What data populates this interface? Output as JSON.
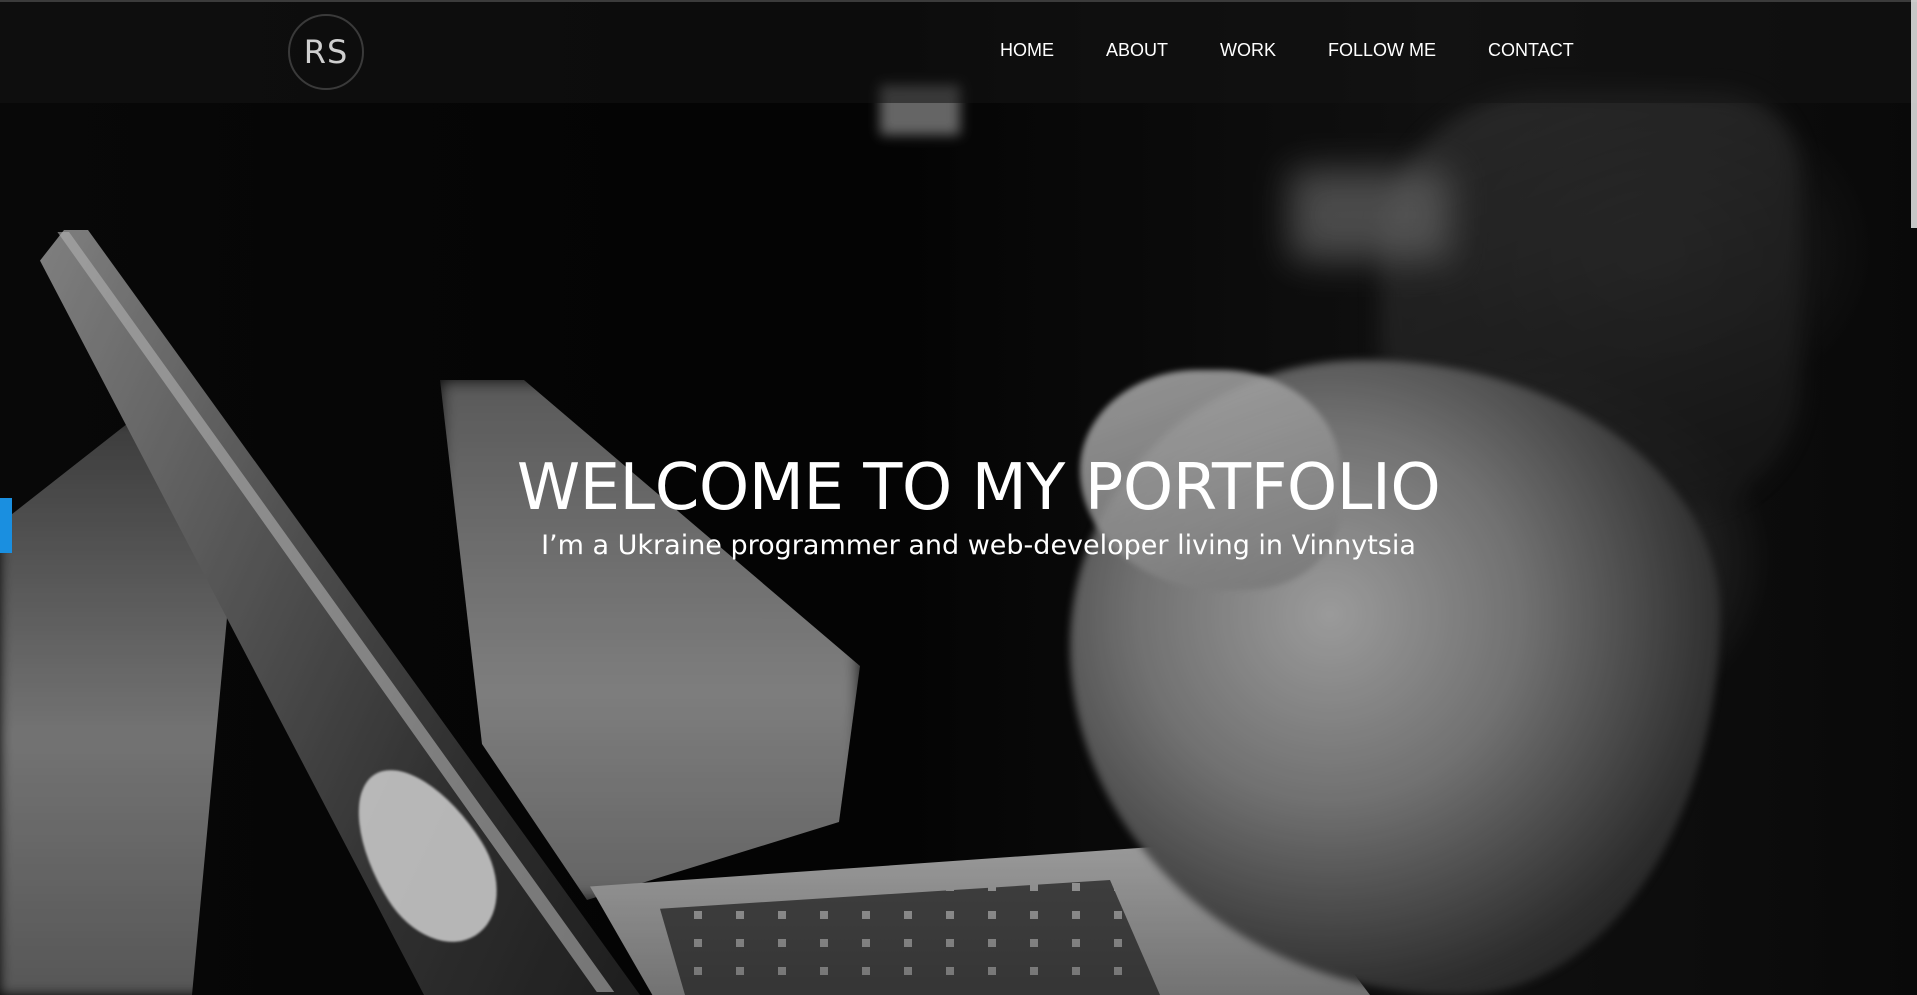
{
  "header": {
    "logo_text": "RS",
    "nav": [
      {
        "label": "HOME"
      },
      {
        "label": "ABOUT"
      },
      {
        "label": "WORK"
      },
      {
        "label": "FOLLOW ME"
      },
      {
        "label": "CONTACT"
      }
    ]
  },
  "hero": {
    "title": "WELCOME TO MY PORTFOLIO",
    "subtitle": "I’m a Ukraine programmer and web-developer living in Vinnytsia"
  },
  "colors": {
    "accent_tab": "#1a8fe0",
    "text": "#ffffff"
  }
}
